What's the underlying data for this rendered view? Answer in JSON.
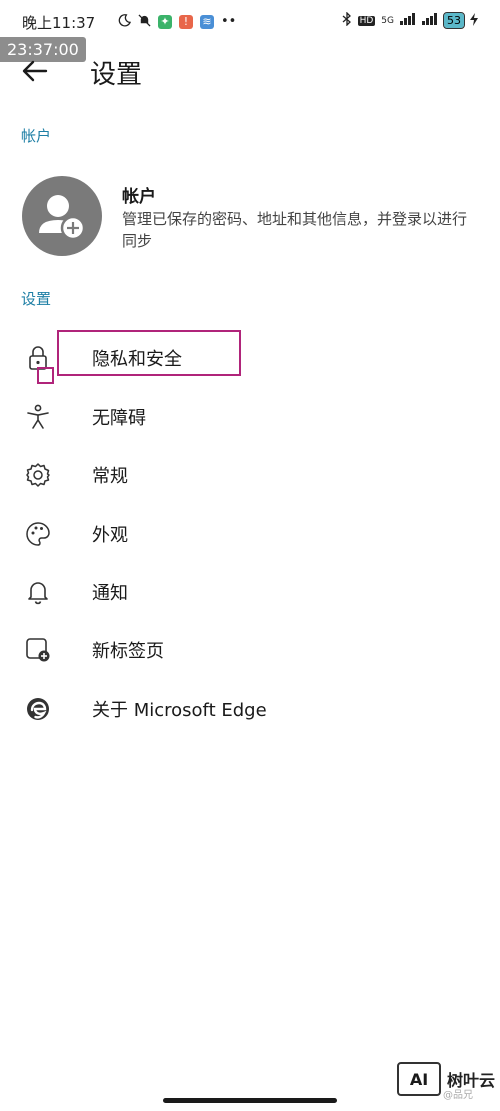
{
  "status_bar": {
    "time": "晚上11:37",
    "network": "5G",
    "hd": "HD",
    "battery": "53"
  },
  "overlay_timestamp": "23:37:00",
  "header": {
    "title": "设置"
  },
  "account_section": {
    "label": "帐户",
    "title": "帐户",
    "description": "管理已保存的密码、地址和其他信息，并登录以进行同步"
  },
  "settings_section": {
    "label": "设置",
    "items": [
      {
        "label": "隐私和安全",
        "icon": "lock-icon"
      },
      {
        "label": "无障碍",
        "icon": "accessibility-icon"
      },
      {
        "label": "常规",
        "icon": "gear-icon"
      },
      {
        "label": "外观",
        "icon": "palette-icon"
      },
      {
        "label": "通知",
        "icon": "bell-icon"
      },
      {
        "label": "新标签页",
        "icon": "new-tab-icon"
      },
      {
        "label": "关于 Microsoft Edge",
        "icon": "edge-logo-icon"
      }
    ]
  },
  "watermark": {
    "logo": "AI",
    "text": "树叶云",
    "sub": "@品兄"
  },
  "colors": {
    "accent": "#1e7fa5",
    "highlight": "#b0247a",
    "avatar_bg": "#7a7a7a"
  }
}
